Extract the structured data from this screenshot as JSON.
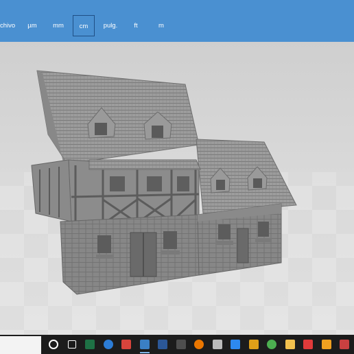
{
  "units_toolbar": {
    "items": [
      {
        "label": "chivo",
        "selected": false
      },
      {
        "label": "µm",
        "selected": false
      },
      {
        "label": "mm",
        "selected": false
      },
      {
        "label": "cm",
        "selected": true
      },
      {
        "label": "pulg.",
        "selected": false
      },
      {
        "label": "ft",
        "selected": false
      },
      {
        "label": "m",
        "selected": false
      }
    ],
    "background_color": "#4a90d1"
  },
  "viewport": {
    "model": "3d-medieval-house-model",
    "model_color": "#8e8e8e"
  },
  "taskbar": {
    "icons": [
      {
        "name": "cortana-circle-icon",
        "color": "#ffffff"
      },
      {
        "name": "task-view-icon",
        "color": "#ffffff"
      },
      {
        "name": "excel-icon",
        "color": "#1e7145"
      },
      {
        "name": "edge-icon",
        "color": "#2c7cd6"
      },
      {
        "name": "snipping-tool-icon",
        "color": "#d8443c"
      },
      {
        "name": "app-icon-active",
        "color": "#3a7fc4"
      },
      {
        "name": "word-icon",
        "color": "#2b5797"
      },
      {
        "name": "calculator-icon",
        "color": "#4e4e4e"
      },
      {
        "name": "blender-icon",
        "color": "#ea7600"
      },
      {
        "name": "inkscape-icon",
        "color": "#bbbbbb"
      },
      {
        "name": "photo-app-icon",
        "color": "#2d89ef"
      },
      {
        "name": "shield-app-icon",
        "color": "#e0a018"
      },
      {
        "name": "chrome-icon",
        "color": "#4caf50"
      },
      {
        "name": "file-explorer-icon",
        "color": "#f2c14e"
      },
      {
        "name": "anydesk-icon",
        "color": "#e03a3a"
      },
      {
        "name": "ib-app-icon",
        "color": "#f0a020"
      },
      {
        "name": "extra-app-icon",
        "color": "#c94040"
      }
    ]
  }
}
